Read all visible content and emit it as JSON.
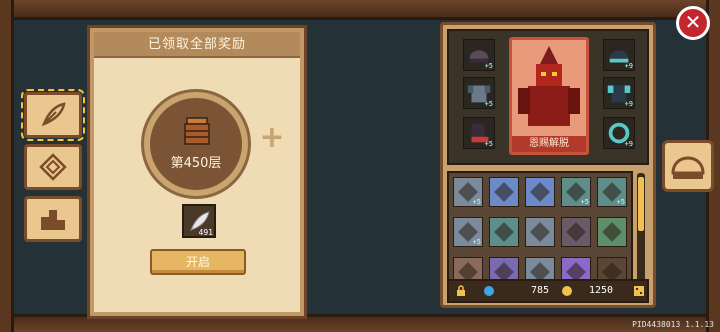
{
  "panel": {
    "title": "已领取全部奖励",
    "floor_label": "第450层",
    "item_count": "491",
    "open_button": "开启"
  },
  "left_tabs": [
    {
      "name": "tab-feather",
      "icon": "feather-icon",
      "active": true
    },
    {
      "name": "tab-emblem",
      "icon": "emblem-icon",
      "active": false
    },
    {
      "name": "tab-ranking",
      "icon": "podium-icon",
      "active": false
    }
  ],
  "character": {
    "title": "恩赐解脱"
  },
  "equipment": [
    {
      "icon": "helmet-icon",
      "level": "+5"
    },
    {
      "icon": "helmet-icon",
      "level": "+9"
    },
    {
      "icon": "armor-icon",
      "level": "+5"
    },
    {
      "icon": "armor-icon",
      "level": "+9"
    },
    {
      "icon": "boots-icon",
      "level": "+5"
    },
    {
      "icon": "ring-icon",
      "level": "+9"
    }
  ],
  "inventory": [
    {
      "icon": "sword-icon",
      "level": "+5",
      "bg": "#7a8a9a"
    },
    {
      "icon": "rainbow-potion-icon",
      "level": "",
      "bg": "#6c8ac8"
    },
    {
      "icon": "rainbow-potion-icon",
      "level": "",
      "bg": "#6c8ac8"
    },
    {
      "icon": "ore-icon",
      "level": "+5",
      "bg": "#5e8e8a"
    },
    {
      "icon": "ore-icon",
      "level": "+5",
      "bg": "#5e8e8a"
    },
    {
      "icon": "ingot-icon",
      "level": "+5",
      "bg": "#7a8a9a"
    },
    {
      "icon": "potion-icon",
      "level": "",
      "bg": "#5e8e8a"
    },
    {
      "icon": "hammer-icon",
      "level": "",
      "bg": "#7a8a9a"
    },
    {
      "icon": "dagger-icon",
      "level": "",
      "bg": "#6a5a6a"
    },
    {
      "icon": "spear-icon",
      "level": "",
      "bg": "#5e8e6a"
    },
    {
      "icon": "drum-icon",
      "level": "",
      "bg": "#8a6a5a"
    },
    {
      "icon": "axe-icon",
      "level": "",
      "bg": "#7a6ab0"
    },
    {
      "icon": "mace-icon",
      "level": "",
      "bg": "#7a8a9a"
    },
    {
      "icon": "cannon-icon",
      "level": "",
      "bg": "#8a6ac8"
    },
    {
      "icon": "empty-slot-icon",
      "level": "",
      "bg": "#5a4634"
    }
  ],
  "currency": {
    "gems": "785",
    "gold": "1250"
  },
  "version": "PID4438013 1.1.13"
}
